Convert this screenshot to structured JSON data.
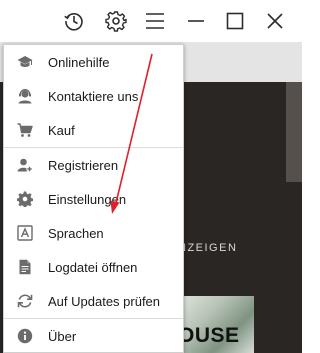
{
  "menu": {
    "items": [
      {
        "label": "Onlinehilfe",
        "icon": "graduation-cap-icon"
      },
      {
        "label": "Kontaktiere uns",
        "icon": "support-person-icon"
      },
      {
        "label": "Kauf",
        "icon": "cart-icon"
      },
      {
        "label": "Registrieren",
        "icon": "user-add-icon"
      },
      {
        "label": "Einstellungen",
        "icon": "gear-icon"
      },
      {
        "label": "Sprachen",
        "icon": "language-icon"
      },
      {
        "label": "Logdatei öffnen",
        "icon": "document-icon"
      },
      {
        "label": "Auf Updates prüfen",
        "icon": "refresh-icon"
      },
      {
        "label": "Über",
        "icon": "info-icon"
      }
    ]
  },
  "background": {
    "label_fragment": "NZEIGEN",
    "thumbnail_text": "OUSE"
  },
  "colors": {
    "icon_gray": "#6b6b6b",
    "annotation_red": "#e0202a",
    "dark_bg": "#2a2623"
  }
}
